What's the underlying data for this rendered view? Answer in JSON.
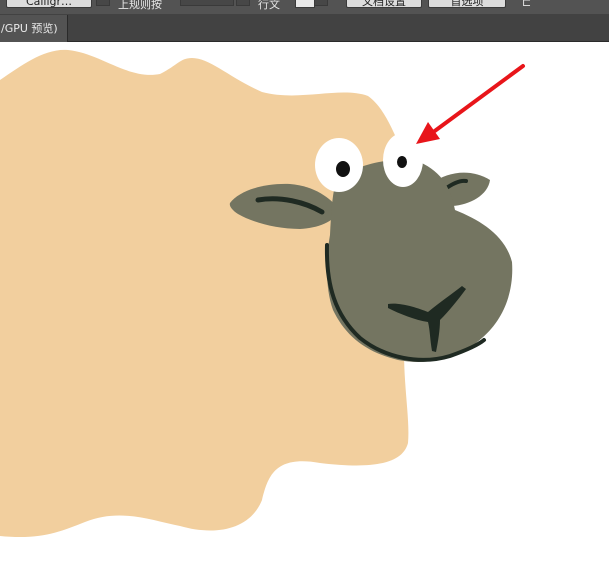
{
  "toolbar": {
    "font_button": "Calligr…",
    "align_label": "上规则按",
    "text_label": "行文",
    "doc_setup_button": "文档设置",
    "preferences_button": "首选项"
  },
  "tab": {
    "label": "/GPU 预览)"
  },
  "colors": {
    "body_fill": "#f2cf9e",
    "face_fill": "#747561",
    "outline": "#1f2a22",
    "arrow": "#e8151a",
    "eye_white": "#ffffff",
    "pupil": "#111111"
  }
}
